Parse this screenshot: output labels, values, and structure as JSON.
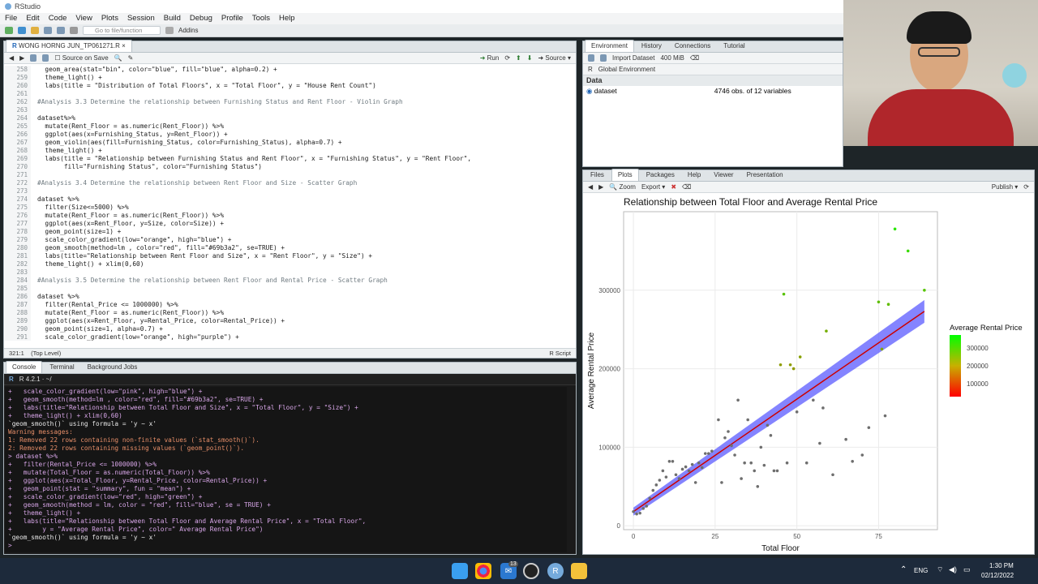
{
  "window": {
    "title": "RStudio"
  },
  "menu": [
    "File",
    "Edit",
    "Code",
    "View",
    "Plots",
    "Session",
    "Build",
    "Debug",
    "Profile",
    "Tools",
    "Help"
  ],
  "toolbar": {
    "goto_placeholder": "Go to file/function",
    "addins": "Addins"
  },
  "editor": {
    "file_tab": "WONG HORNG JUN_TP061271.R",
    "source_on_save": "Source on Save",
    "run": "Run",
    "source": "Source",
    "status_pos": "321:1",
    "status_scope": "(Top Level)",
    "status_type": "R Script",
    "lines": [
      {
        "n": "258",
        "t": "  geom_area(stat=\"bin\", color=\"blue\", fill=\"blue\", alpha=0.2) +"
      },
      {
        "n": "259",
        "t": "  theme_light() +"
      },
      {
        "n": "260",
        "t": "  labs(title = \"Distribution of Total Floors\", x = \"Total Floor\", y = \"House Rent Count\")"
      },
      {
        "n": "261",
        "t": ""
      },
      {
        "n": "262",
        "t": "#Analysis 3.3 Determine the relationship between Furnishing Status and Rent Floor - Violin Graph"
      },
      {
        "n": "263",
        "t": ""
      },
      {
        "n": "264",
        "t": "dataset%>%"
      },
      {
        "n": "265",
        "t": "  mutate(Rent_Floor = as.numeric(Rent_Floor)) %>%"
      },
      {
        "n": "266",
        "t": "  ggplot(aes(x=Furnishing_Status, y=Rent_Floor)) +"
      },
      {
        "n": "267",
        "t": "  geom_violin(aes(fill=Furnishing_Status, color=Furnishing_Status), alpha=0.7) +"
      },
      {
        "n": "268",
        "t": "  theme_light() +"
      },
      {
        "n": "269",
        "t": "  labs(title = \"Relationship between Furnishing Status and Rent Floor\", x = \"Furnishing Status\", y = \"Rent Floor\","
      },
      {
        "n": "270",
        "t": "       fill=\"Furnishing Status\", color=\"Furnishing Status\")"
      },
      {
        "n": "271",
        "t": ""
      },
      {
        "n": "272",
        "t": "#Analysis 3.4 Determine the relationship between Rent Floor and Size - Scatter Graph"
      },
      {
        "n": "273",
        "t": ""
      },
      {
        "n": "274",
        "t": "dataset %>%"
      },
      {
        "n": "275",
        "t": "  filter(Size<=5000) %>%"
      },
      {
        "n": "276",
        "t": "  mutate(Rent_Floor = as.numeric(Rent_Floor)) %>%"
      },
      {
        "n": "277",
        "t": "  ggplot(aes(x=Rent_Floor, y=Size, color=Size)) +"
      },
      {
        "n": "278",
        "t": "  geom_point(size=1) +"
      },
      {
        "n": "279",
        "t": "  scale_color_gradient(low=\"orange\", high=\"blue\") +"
      },
      {
        "n": "280",
        "t": "  geom_smooth(method=lm , color=\"red\", fill=\"#69b3a2\", se=TRUE) +"
      },
      {
        "n": "281",
        "t": "  labs(title=\"Relationship between Rent Floor and Size\", x = \"Rent Floor\", y = \"Size\") +"
      },
      {
        "n": "282",
        "t": "  theme_light() + xlim(0,60)"
      },
      {
        "n": "283",
        "t": ""
      },
      {
        "n": "284",
        "t": "#Analysis 3.5 Determine the relationship between Rent Floor and Rental Price - Scatter Graph"
      },
      {
        "n": "285",
        "t": ""
      },
      {
        "n": "286",
        "t": "dataset %>%"
      },
      {
        "n": "287",
        "t": "  filter(Rental_Price <= 1000000) %>%"
      },
      {
        "n": "288",
        "t": "  mutate(Rent_Floor = as.numeric(Rent_Floor)) %>%"
      },
      {
        "n": "289",
        "t": "  ggplot(aes(x=Rent_Floor, y=Rental_Price, color=Rental_Price)) +"
      },
      {
        "n": "290",
        "t": "  geom_point(size=1, alpha=0.7) +"
      },
      {
        "n": "291",
        "t": "  scale_color_gradient(low=\"orange\", high=\"purple\") +"
      },
      {
        "n": "292",
        "t": ""
      }
    ]
  },
  "console": {
    "tabs": [
      "Console",
      "Terminal",
      "Background Jobs"
    ],
    "r_version": "R 4.2.1 · ~/",
    "lines": [
      {
        "k": "cmd",
        "t": "+   scale_color_gradient(low=\"pink\", high=\"blue\") +"
      },
      {
        "k": "cmd",
        "t": "+   geom_smooth(method=lm , color=\"red\", fill=\"#69b3a2\", se=TRUE) +"
      },
      {
        "k": "cmd",
        "t": "+   labs(title=\"Relationship between Total Floor and Size\", x = \"Total Floor\", y = \"Size\") +"
      },
      {
        "k": "cmd",
        "t": "+   theme_light() + xlim(0,60)"
      },
      {
        "k": "out",
        "t": "`geom_smooth()` using formula = 'y ~ x'"
      },
      {
        "k": "warn",
        "t": "Warning messages:"
      },
      {
        "k": "warn",
        "t": "1: Removed 22 rows containing non-finite values (`stat_smooth()`)."
      },
      {
        "k": "warn",
        "t": "2: Removed 22 rows containing missing values (`geom_point()`)."
      },
      {
        "k": "cmd",
        "t": "> dataset %>%"
      },
      {
        "k": "cmd",
        "t": "+   filter(Rental_Price <= 1000000) %>%"
      },
      {
        "k": "cmd",
        "t": "+   mutate(Total_Floor = as.numeric(Total_Floor)) %>%"
      },
      {
        "k": "cmd",
        "t": "+   ggplot(aes(x=Total_Floor, y=Rental_Price, color=Rental_Price)) +"
      },
      {
        "k": "cmd",
        "t": "+   geom_point(stat = \"summary\", fun = \"mean\") +"
      },
      {
        "k": "cmd",
        "t": "+   scale_color_gradient(low=\"red\", high=\"green\") +"
      },
      {
        "k": "cmd",
        "t": "+   geom_smooth(method = lm, color = \"red\", fill=\"blue\", se = TRUE) +"
      },
      {
        "k": "cmd",
        "t": "+   theme_light() +"
      },
      {
        "k": "cmd",
        "t": "+   labs(title=\"Relationship between Total Floor and Average Rental Price\", x = \"Total Floor\","
      },
      {
        "k": "cmd",
        "t": "+        y = \"Average Rental Price\", color=\" Average Rental Price\")"
      },
      {
        "k": "out",
        "t": "`geom_smooth()` using formula = 'y ~ x'"
      },
      {
        "k": "cmd",
        "t": ">"
      }
    ]
  },
  "env": {
    "tabs": [
      "Environment",
      "History",
      "Connections",
      "Tutorial"
    ],
    "import": "Import Dataset",
    "mem": "400 MiB",
    "lang": "R",
    "scope": "Global Environment",
    "section": "Data",
    "rows": [
      {
        "name": "dataset",
        "value": "4746 obs. of 12 variables"
      }
    ]
  },
  "plots": {
    "tabs": [
      "Files",
      "Plots",
      "Packages",
      "Help",
      "Viewer",
      "Presentation"
    ],
    "zoom": "Zoom",
    "export": "Export",
    "publish": "Publish"
  },
  "chart_data": {
    "type": "scatter",
    "title": "Relationship between Total Floor and Average Rental Price",
    "xlabel": "Total Floor",
    "ylabel": "Average Rental Price",
    "xlim": [
      -3,
      93
    ],
    "ylim": [
      -5000,
      400000
    ],
    "xticks": [
      "0",
      "25",
      "50",
      "75"
    ],
    "yticks": [
      "0",
      "100000",
      "200000",
      "300000"
    ],
    "legend": {
      "title": "Average Rental Price",
      "labels": [
        "300000",
        "200000",
        "100000"
      ],
      "low": "#ff0000",
      "high": "#00ff00"
    },
    "trend": {
      "x0": 0,
      "y0": 18000,
      "x1": 89,
      "y1": 273000,
      "color": "#cc0000",
      "band": "#5b5bff"
    },
    "points": [
      [
        0,
        18000
      ],
      [
        1,
        15000
      ],
      [
        2,
        16000
      ],
      [
        3,
        22000
      ],
      [
        4,
        25000
      ],
      [
        5,
        35000
      ],
      [
        6,
        45000
      ],
      [
        7,
        52000
      ],
      [
        8,
        58000
      ],
      [
        9,
        70000
      ],
      [
        10,
        62000
      ],
      [
        11,
        82000
      ],
      [
        12,
        82000
      ],
      [
        13,
        65000
      ],
      [
        14,
        60000
      ],
      [
        15,
        72000
      ],
      [
        16,
        75000
      ],
      [
        17,
        70000
      ],
      [
        18,
        78000
      ],
      [
        19,
        55000
      ],
      [
        20,
        80000
      ],
      [
        21,
        74000
      ],
      [
        22,
        92000
      ],
      [
        23,
        92000
      ],
      [
        24,
        95000
      ],
      [
        26,
        135000
      ],
      [
        27,
        55000
      ],
      [
        28,
        112000
      ],
      [
        29,
        120000
      ],
      [
        30,
        102000
      ],
      [
        31,
        90000
      ],
      [
        32,
        160000
      ],
      [
        33,
        60000
      ],
      [
        34,
        80000
      ],
      [
        35,
        135000
      ],
      [
        36,
        80000
      ],
      [
        37,
        70000
      ],
      [
        38,
        50000
      ],
      [
        39,
        100000
      ],
      [
        40,
        77000
      ],
      [
        41,
        128000
      ],
      [
        42,
        115000
      ],
      [
        43,
        70000
      ],
      [
        44,
        70000
      ],
      [
        45,
        205000
      ],
      [
        46,
        295000
      ],
      [
        47,
        80000
      ],
      [
        48,
        205000
      ],
      [
        49,
        200000
      ],
      [
        50,
        145000
      ],
      [
        51,
        215000
      ],
      [
        53,
        80000
      ],
      [
        55,
        160000
      ],
      [
        57,
        105000
      ],
      [
        58,
        150000
      ],
      [
        59,
        248000
      ],
      [
        61,
        65000
      ],
      [
        65,
        110000
      ],
      [
        67,
        82000
      ],
      [
        70,
        90000
      ],
      [
        72,
        125000
      ],
      [
        75,
        285000
      ],
      [
        76,
        225000
      ],
      [
        77,
        140000
      ],
      [
        78,
        282000
      ],
      [
        80,
        378000
      ],
      [
        84,
        350000
      ],
      [
        89,
        300000
      ]
    ]
  },
  "taskbar": {
    "lang": "ENG",
    "time": "1:30 PM",
    "date": "02/12/2022",
    "badge": "13"
  }
}
